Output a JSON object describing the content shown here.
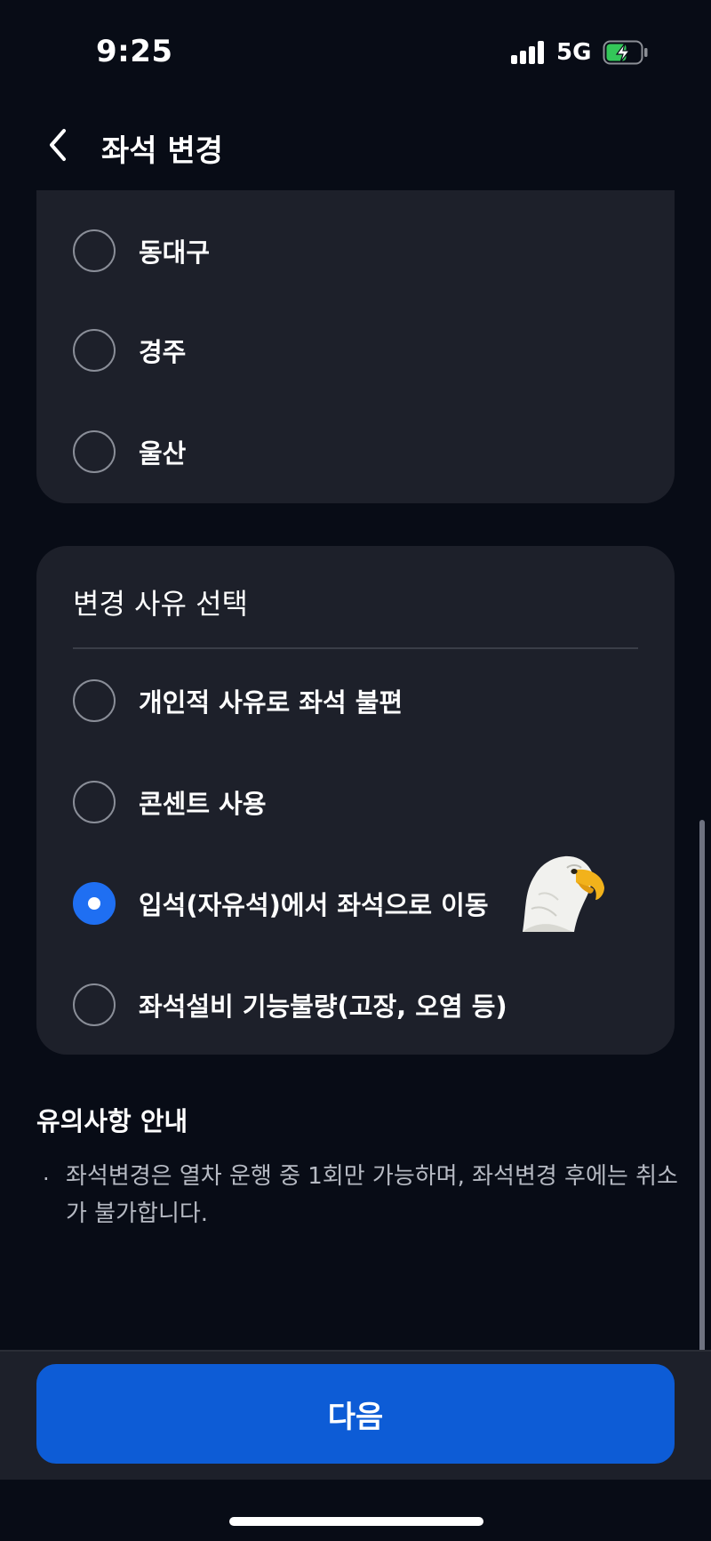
{
  "status_bar": {
    "time": "9:25",
    "network": "5G"
  },
  "header": {
    "title": "좌석 변경"
  },
  "stations": [
    {
      "label": "동대구",
      "selected": false
    },
    {
      "label": "경주",
      "selected": false
    },
    {
      "label": "울산",
      "selected": false
    }
  ],
  "reason": {
    "title": "변경 사유 선택",
    "options": [
      {
        "label": "개인적 사유로 좌석 불편",
        "selected": false
      },
      {
        "label": "콘센트 사용",
        "selected": false
      },
      {
        "label": "입석(자유석)에서 좌석으로 이동",
        "selected": true
      },
      {
        "label": "좌석설비 기능불량(고장, 오염 등)",
        "selected": false
      }
    ]
  },
  "notice": {
    "title": "유의사항 안내",
    "bullet": "·",
    "text": "좌석변경은 열차 운행 중 1회만 가능하며, 좌석변경 후에는 취소가 불가합니다."
  },
  "footer": {
    "next_label": "다음"
  },
  "colors": {
    "accent": "#1f6ff2",
    "button": "#0d5cd6",
    "card": "#1d202a",
    "background": "#080c16",
    "battery_charging": "#34c759"
  },
  "icons": [
    "back-chevron-icon",
    "signal-icon",
    "battery-charging-icon",
    "eagle-sticker"
  ]
}
